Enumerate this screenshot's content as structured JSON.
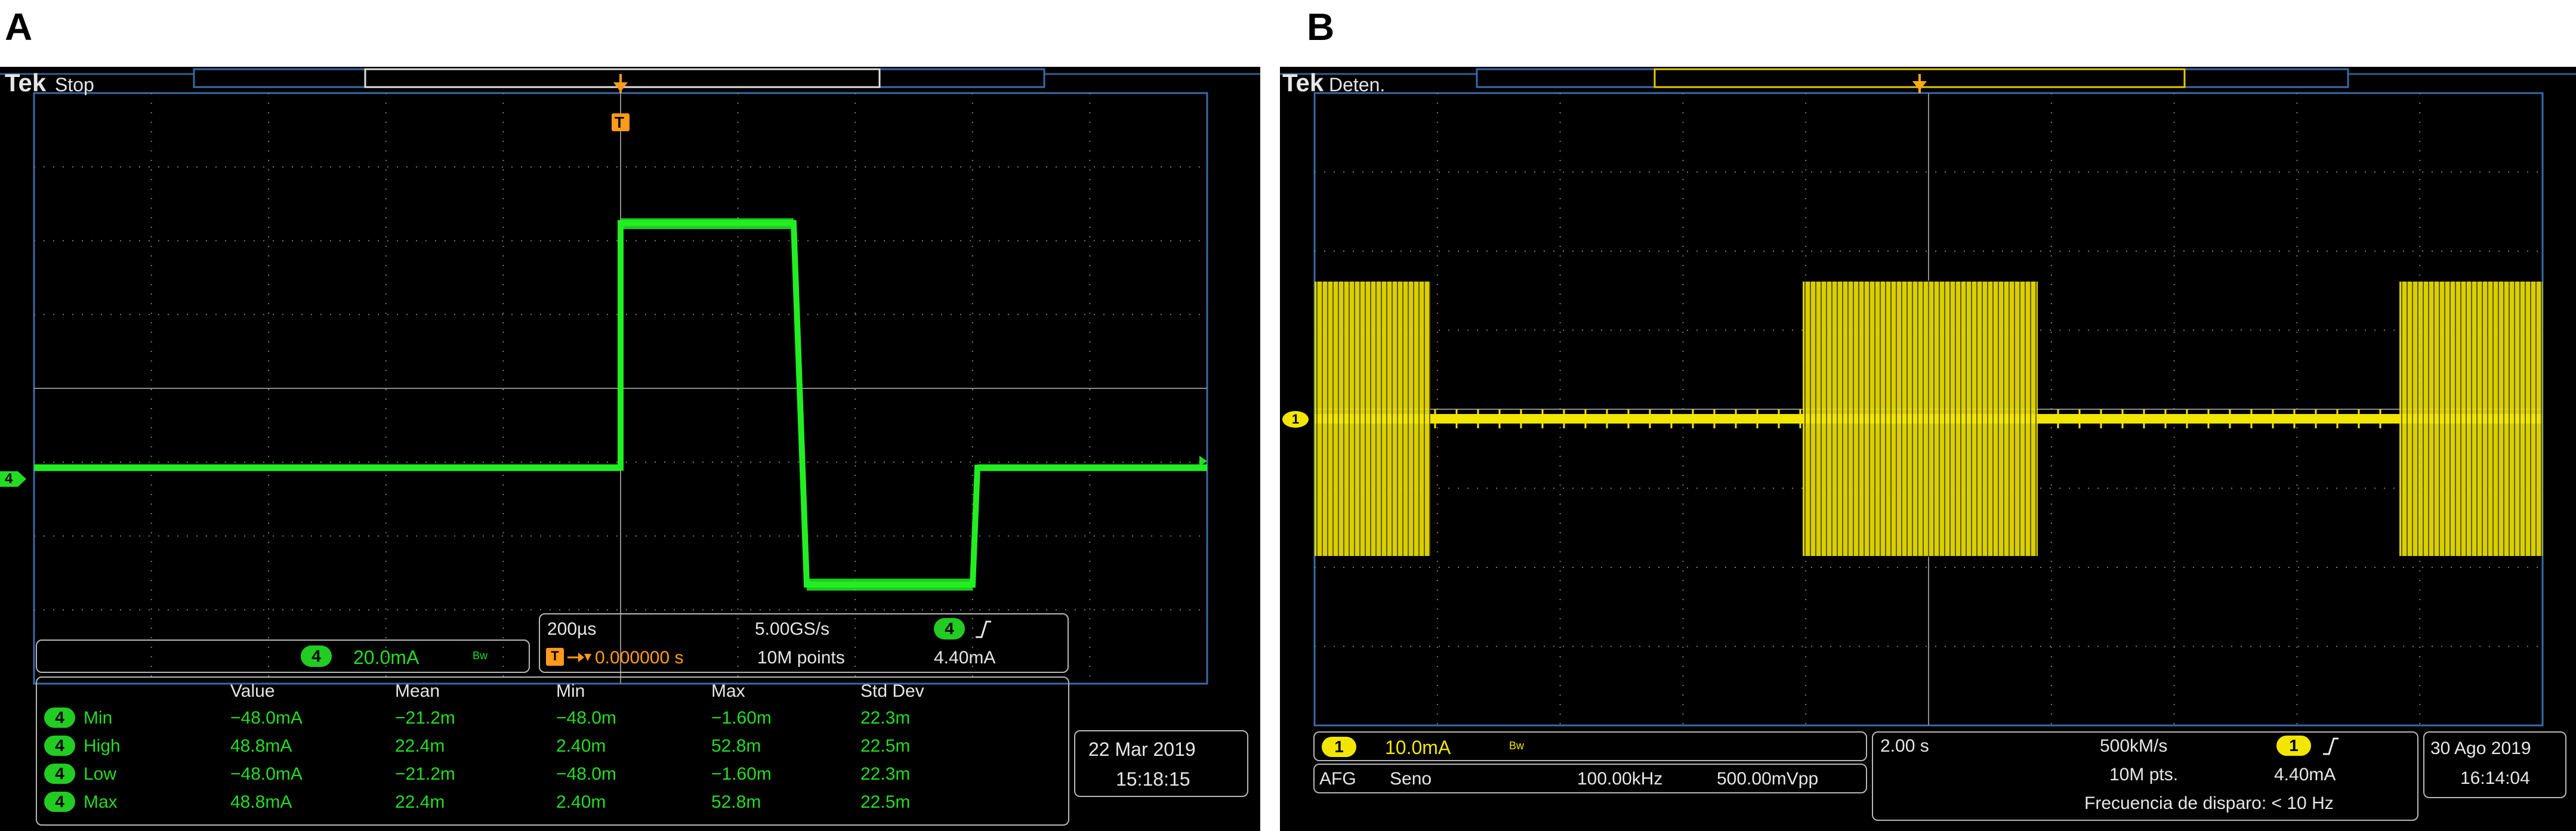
{
  "panel_a": {
    "label": "A",
    "brand": "Tek",
    "run_state": "Stop",
    "trigger_marker": "T",
    "channel_marker": "4",
    "channel_scale": {
      "channel": "4",
      "value": "20.0mA",
      "bw_icon": "Bw"
    },
    "horizontal": {
      "time_div": "200µs",
      "sample_rate": "5.00GS/s",
      "trig_channel": "4",
      "trig_slope_icon": "rising-edge-icon",
      "trig_position_icon": "T",
      "trig_delay": "0.000000 s",
      "record_length": "10M points",
      "trig_level": "4.40mA"
    },
    "measurements": {
      "columns": [
        "",
        "Value",
        "Mean",
        "Min",
        "Max",
        "Std Dev"
      ],
      "rows": [
        {
          "ch": "4",
          "name": "Min",
          "value": "−48.0mA",
          "mean": "−21.2m",
          "min": "−48.0m",
          "max": "−1.60m",
          "std": "22.3m"
        },
        {
          "ch": "4",
          "name": "High",
          "value": "48.8mA",
          "mean": "22.4m",
          "min": "2.40m",
          "max": "52.8m",
          "std": "22.5m"
        },
        {
          "ch": "4",
          "name": "Low",
          "value": "−48.0mA",
          "mean": "−21.2m",
          "min": "−48.0m",
          "max": "−1.60m",
          "std": "22.3m"
        },
        {
          "ch": "4",
          "name": "Max",
          "value": "48.8mA",
          "mean": "22.4m",
          "min": "2.40m",
          "max": "52.8m",
          "std": "22.5m"
        }
      ]
    },
    "date": "22 Mar 2019",
    "time": "15:18:15",
    "trace_color": "#22ee22"
  },
  "panel_b": {
    "label": "B",
    "brand": "Tek",
    "run_state": "Deten.",
    "trigger_marker": "T",
    "channel_marker": "1",
    "channel_scale": {
      "channel": "1",
      "value": "10.0mA",
      "bw_icon": "Bw"
    },
    "afg": {
      "label": "AFG",
      "wave": "Seno",
      "freq": "100.00kHz",
      "amplitude": "500.00mVpp"
    },
    "horizontal": {
      "time_div": "2.00 s",
      "sample_rate": "500kM/s",
      "trig_channel": "1",
      "trig_slope_icon": "rising-edge-icon",
      "record_length": "10M pts.",
      "trig_level": "4.40mA",
      "trig_freq": "Frecuencia de disparo: < 10 Hz"
    },
    "date": "30 Ago 2019",
    "time": "16:14:04",
    "trace_color": "#f2e600"
  }
}
